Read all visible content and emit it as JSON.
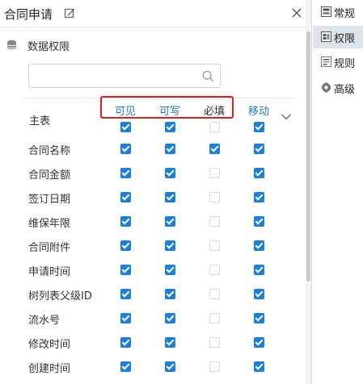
{
  "header": {
    "title": "合同申请"
  },
  "permissions": {
    "label": "数据权限"
  },
  "search": {
    "value": "",
    "placeholder": ""
  },
  "columns": [
    {
      "label": "可见",
      "color": "#1e78c8"
    },
    {
      "label": "可写",
      "color": "#1e78c8"
    },
    {
      "label": "必填",
      "color": "#333333"
    },
    {
      "label": "移动",
      "color": "#1e78c8"
    }
  ],
  "main_table_label": "主表",
  "rows": [
    {
      "label": "主表",
      "visible": true,
      "writable": true,
      "required": false,
      "move": true
    },
    {
      "label": "合同名称",
      "visible": true,
      "writable": true,
      "required": true,
      "move": true
    },
    {
      "label": "合同金额",
      "visible": true,
      "writable": true,
      "required": false,
      "move": true
    },
    {
      "label": "签订日期",
      "visible": true,
      "writable": true,
      "required": false,
      "move": true
    },
    {
      "label": "维保年限",
      "visible": true,
      "writable": true,
      "required": false,
      "move": true
    },
    {
      "label": "合同附件",
      "visible": true,
      "writable": true,
      "required": false,
      "move": true
    },
    {
      "label": "申请时间",
      "visible": true,
      "writable": true,
      "required": false,
      "move": true
    },
    {
      "label": "树列表父级ID",
      "visible": true,
      "writable": true,
      "required": false,
      "move": true
    },
    {
      "label": "流水号",
      "visible": true,
      "writable": true,
      "required": false,
      "move": true
    },
    {
      "label": "修改时间",
      "visible": true,
      "writable": true,
      "required": false,
      "move": true
    },
    {
      "label": "创建时间",
      "visible": true,
      "writable": true,
      "required": false,
      "move": true
    }
  ],
  "tabs": [
    {
      "label": "常规",
      "icon": "settings-icon",
      "active": false
    },
    {
      "label": "权限",
      "icon": "permission-icon",
      "active": true
    },
    {
      "label": "规则",
      "icon": "rules-icon",
      "active": false
    },
    {
      "label": "高级",
      "icon": "advanced-icon",
      "active": false
    }
  ],
  "colors": {
    "accent": "#1c7fd8",
    "highlight_box": "#e31c1c",
    "active_tab": "#dde3ea"
  }
}
